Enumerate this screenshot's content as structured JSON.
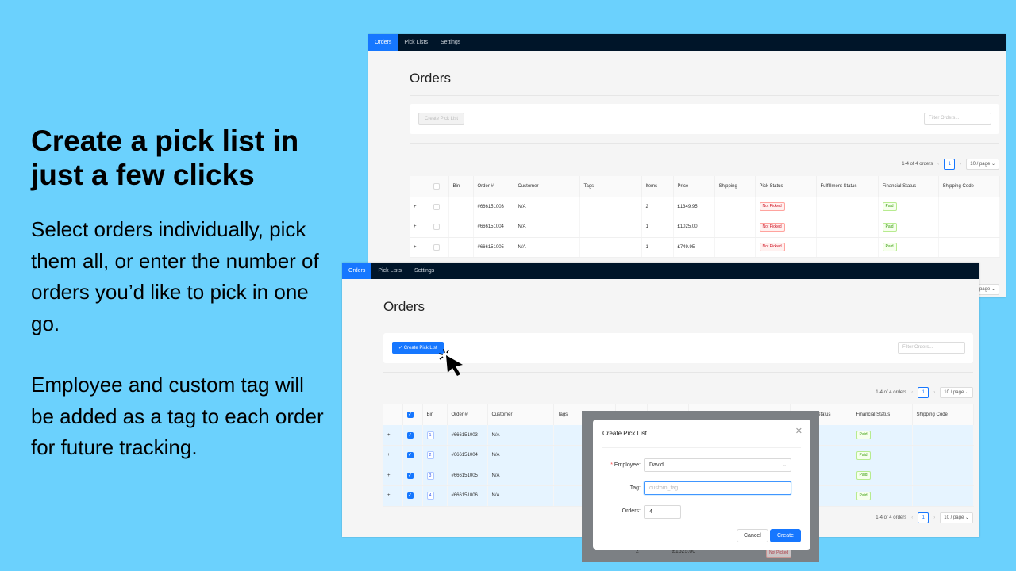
{
  "marketing": {
    "headline": "Create a pick list in just a few clicks",
    "paragraph1": "Select orders individually, pick them all, or enter the number of orders you’d like to pick in one go.",
    "paragraph2": "Employee and custom tag will be added as a tag to each order for future tracking."
  },
  "nav": {
    "items": [
      "Orders",
      "Pick Lists",
      "Settings"
    ],
    "active": "Orders"
  },
  "page": {
    "title": "Orders",
    "create_pick_list": "Create Pick List",
    "filter_placeholder": "Filter Orders...",
    "pagination": {
      "range": "1-4 of 4 orders",
      "current_page": "1",
      "page_size": "10 / page",
      "prev": "‹",
      "next": "›"
    }
  },
  "columns": [
    "",
    "",
    "Bin",
    "Order #",
    "Customer",
    "Tags",
    "Items",
    "Price",
    "Shipping",
    "Pick Status",
    "Fulfillment Status",
    "Financial Status",
    "Shipping Code"
  ],
  "screen1_rows": [
    {
      "order": "#666151003",
      "customer": "N/A",
      "items": "2",
      "price": "£1349.95",
      "pick_status": "Not Picked",
      "financial_status": "Paid"
    },
    {
      "order": "#666151004",
      "customer": "N/A",
      "items": "1",
      "price": "£1025.00",
      "pick_status": "Not Picked",
      "financial_status": "Paid"
    },
    {
      "order": "#666151005",
      "customer": "N/A",
      "items": "1",
      "price": "£749.95",
      "pick_status": "Not Picked",
      "financial_status": "Paid"
    }
  ],
  "screen2_rows": [
    {
      "bin": "1",
      "order": "#666151003",
      "customer": "N/A",
      "financial_status": "Paid"
    },
    {
      "bin": "2",
      "order": "#666151004",
      "customer": "N/A",
      "financial_status": "Paid"
    },
    {
      "bin": "3",
      "order": "#666151005",
      "customer": "N/A",
      "financial_status": "Paid"
    },
    {
      "bin": "4",
      "order": "#666151006",
      "customer": "N/A",
      "financial_status": "Paid"
    }
  ],
  "underlay_row": {
    "items": "2",
    "price": "£1625.00",
    "pick_status": "Not Picked"
  },
  "modal": {
    "title": "Create Pick List",
    "employee_label": "Employee",
    "employee_value": "David",
    "tag_label": "Tag",
    "tag_placeholder": "custom_tag",
    "orders_label": "Orders",
    "orders_value": "4",
    "cancel": "Cancel",
    "create": "Create"
  },
  "colors": {
    "background": "#6bd1fd",
    "primary": "#1677ff",
    "nav": "#001529"
  }
}
